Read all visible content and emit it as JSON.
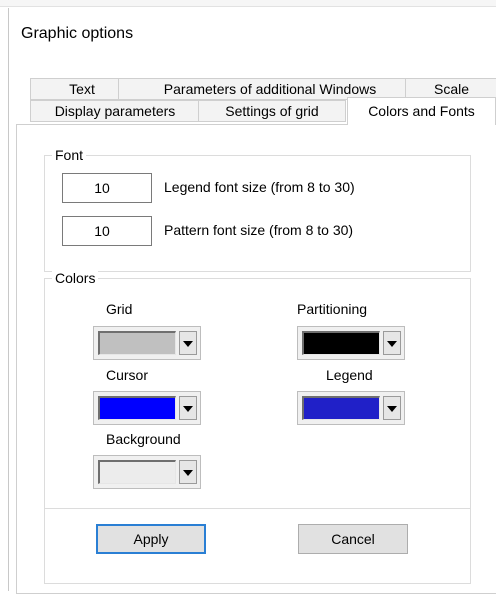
{
  "window": {
    "title": "Graphic options"
  },
  "tabs": {
    "row1": [
      {
        "label": "Text"
      },
      {
        "label": "Parameters of additional Windows"
      },
      {
        "label": "Scale"
      }
    ],
    "row2": [
      {
        "label": "Display parameters"
      },
      {
        "label": "Settings of grid"
      },
      {
        "label": "Colors and Fonts",
        "active": true
      }
    ]
  },
  "font": {
    "group_label": "Font",
    "legend_size": {
      "value": "10",
      "label": "Legend font size (from 8 to 30)"
    },
    "pattern_size": {
      "value": "10",
      "label": "Pattern font size (from 8 to 30)"
    }
  },
  "colors": {
    "group_label": "Colors",
    "items": [
      {
        "label": "Grid",
        "color": "#c0c0c0"
      },
      {
        "label": "Partitioning",
        "color": "#000000"
      },
      {
        "label": "Cursor",
        "color": "#0000ff"
      },
      {
        "label": "Legend",
        "color": "#2020c8"
      },
      {
        "label": "Background",
        "color": "#ececec"
      }
    ]
  },
  "buttons": {
    "apply": "Apply",
    "cancel": "Cancel"
  }
}
